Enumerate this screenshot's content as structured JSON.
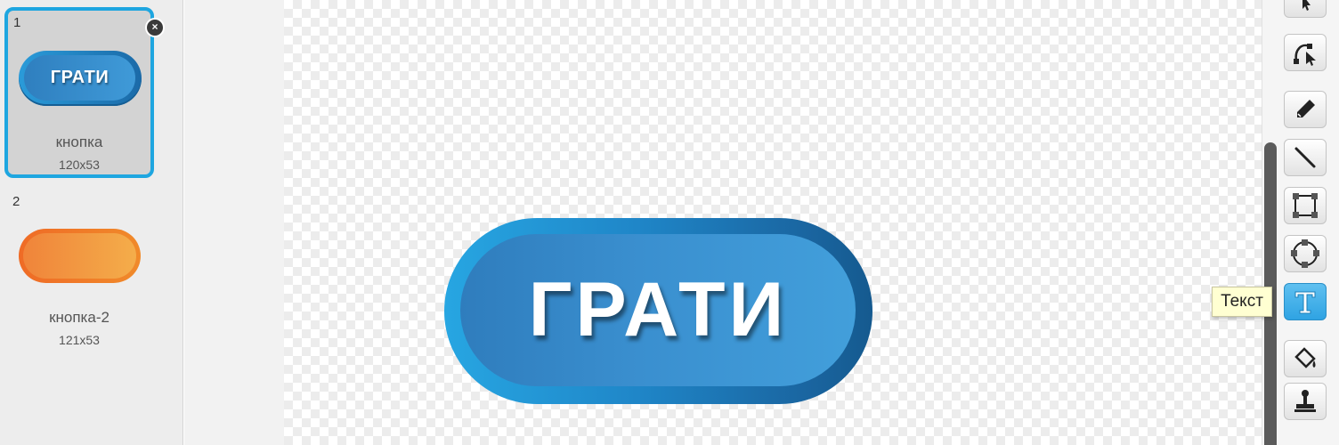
{
  "costumes": [
    {
      "number": "1",
      "label": "ГРАТИ",
      "name": "кнопка",
      "size": "120x53",
      "selected": true
    },
    {
      "number": "2",
      "label": "",
      "name": "кнопка-2",
      "size": "121x53",
      "selected": false
    }
  ],
  "canvas": {
    "button_text": "ГРАТИ"
  },
  "delete_icon": "×",
  "tooltip": "Текст",
  "tools": [
    {
      "name": "select-tool",
      "icon": "arrow-pointer-icon"
    },
    {
      "name": "reshape-tool",
      "icon": "reshape-icon"
    },
    {
      "name": "pencil-tool",
      "icon": "pencil-icon"
    },
    {
      "name": "line-tool",
      "icon": "line-icon"
    },
    {
      "name": "rectangle-tool",
      "icon": "rectangle-icon"
    },
    {
      "name": "ellipse-tool",
      "icon": "ellipse-icon"
    },
    {
      "name": "text-tool",
      "icon": "text-t-icon",
      "active": true
    },
    {
      "name": "fill-tool",
      "icon": "paint-bucket-icon"
    },
    {
      "name": "stamp-tool",
      "icon": "stamp-icon"
    }
  ],
  "colors": {
    "selection_border": "#1ea6e0",
    "button_blue": "#2f7dbd",
    "button_orange": "#f08a2a",
    "active_tool": "#2fa3e3",
    "tooltip_bg": "#ffffd2"
  }
}
